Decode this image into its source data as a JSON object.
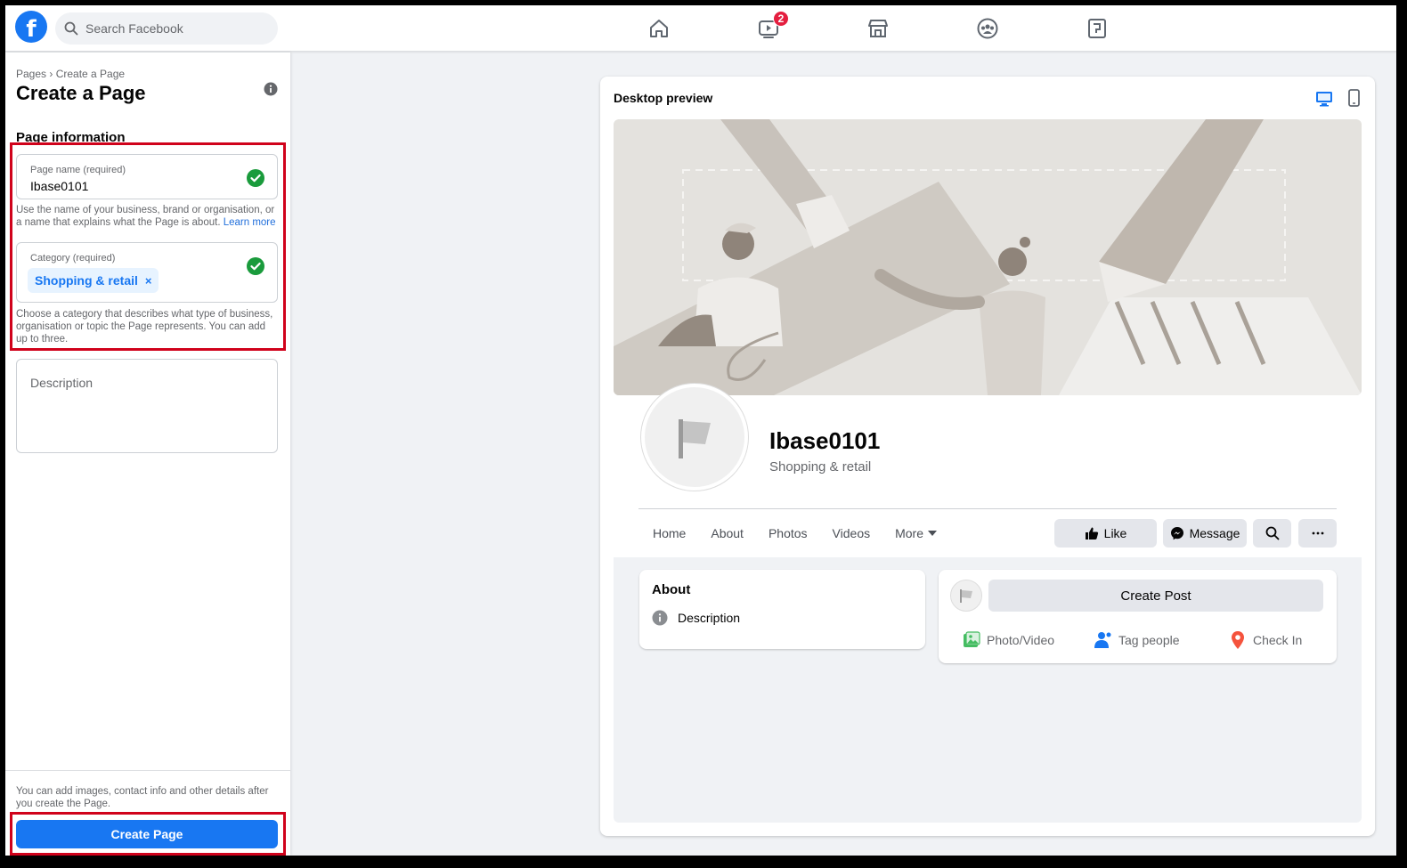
{
  "topbar": {
    "logo_letter": "f",
    "search_placeholder": "Search Facebook",
    "nav": [
      {
        "name": "home",
        "badge": ""
      },
      {
        "name": "watch",
        "badge": "2"
      },
      {
        "name": "marketplace",
        "badge": ""
      },
      {
        "name": "groups",
        "badge": ""
      },
      {
        "name": "gaming",
        "badge": ""
      }
    ]
  },
  "left": {
    "breadcrumb": "Pages › Create a Page",
    "title": "Create a Page",
    "section_title": "Page information",
    "page_name": {
      "label": "Page name (required)",
      "value": "Ibase0101",
      "help": "Use the name of your business, brand or organisation, or a name that explains what the Page is about.",
      "learn_more": "Learn more"
    },
    "category": {
      "label": "Category (required)",
      "chip": "Shopping & retail",
      "chip_remove": "×",
      "help": "Choose a category that describes what type of business, organisation or topic the Page represents. You can add up to three."
    },
    "description": {
      "placeholder": "Description"
    },
    "footer_note": "You can add images, contact info and other details after you create the Page.",
    "create_button": "Create Page"
  },
  "preview": {
    "title": "Desktop preview",
    "page_name": "Ibase0101",
    "page_category": "Shopping & retail",
    "tabs": [
      "Home",
      "About",
      "Photos",
      "Videos",
      "More"
    ],
    "actions": {
      "like": "Like",
      "message": "Message"
    },
    "about": {
      "title": "About",
      "description": "Description"
    },
    "post": {
      "create": "Create Post",
      "photo_video": "Photo/Video",
      "tag_people": "Tag people",
      "check_in": "Check In"
    }
  },
  "colors": {
    "brand": "#1877f2",
    "highlight": "#d0021b",
    "success": "#1a9b3c",
    "badge": "#e41e3f"
  }
}
